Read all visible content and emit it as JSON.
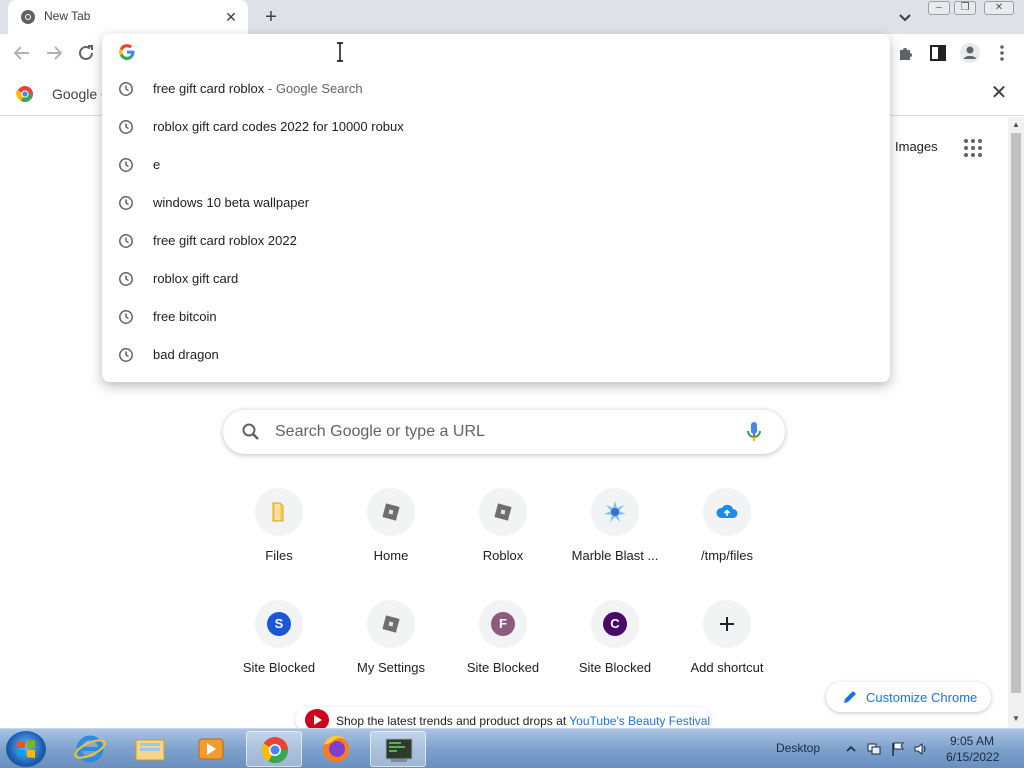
{
  "tab": {
    "title": "New Tab",
    "close_glyph": "✕"
  },
  "new_tab_glyph": "+",
  "window": {
    "minimize": "–",
    "restore": "❐",
    "close": "✕"
  },
  "bookmark": {
    "label": "Google C",
    "close_glyph": "✕"
  },
  "omnibox": {
    "value": "",
    "suggestions": [
      {
        "text": "free gift card roblox",
        "suffix": " - Google Search"
      },
      {
        "text": "roblox gift card codes 2022 for 10000 robux",
        "suffix": ""
      },
      {
        "text": "e",
        "suffix": ""
      },
      {
        "text": "windows 10 beta wallpaper",
        "suffix": ""
      },
      {
        "text": "free gift card roblox 2022",
        "suffix": ""
      },
      {
        "text": "roblox gift card",
        "suffix": ""
      },
      {
        "text": "free bitcoin",
        "suffix": ""
      },
      {
        "text": "bad dragon",
        "suffix": ""
      }
    ]
  },
  "ntp": {
    "images_link": "Images",
    "search_placeholder": "Search Google or type a URL",
    "shortcuts": [
      {
        "label": "Files",
        "icon": "folder-icon"
      },
      {
        "label": "Home",
        "icon": "roblox-icon"
      },
      {
        "label": "Roblox",
        "icon": "roblox-icon"
      },
      {
        "label": "Marble Blast ...",
        "icon": "marble-blast-icon"
      },
      {
        "label": "/tmp/files",
        "icon": "cloud-upload-icon"
      },
      {
        "label": "Site Blocked",
        "icon": "letter-s-icon",
        "letter": "S",
        "color": "#1a57d6"
      },
      {
        "label": "My Settings",
        "icon": "roblox-icon"
      },
      {
        "label": "Site Blocked",
        "icon": "letter-f-icon",
        "letter": "F",
        "color": "#8e5a7e"
      },
      {
        "label": "Site Blocked",
        "icon": "letter-c-icon",
        "letter": "C",
        "color": "#4a0a6a"
      },
      {
        "label": "Add shortcut",
        "icon": "plus-icon"
      }
    ],
    "customize_label": "Customize Chrome",
    "promo": {
      "text": "Shop the latest trends and product drops at ",
      "link": "YouTube's Beauty Festival"
    }
  },
  "taskbar": {
    "desktop_label": "Desktop",
    "time": "9:05 AM",
    "date": "6/15/2022"
  },
  "colors": {
    "accent": "#1a73e8",
    "tabstrip": "#dee1e6"
  }
}
